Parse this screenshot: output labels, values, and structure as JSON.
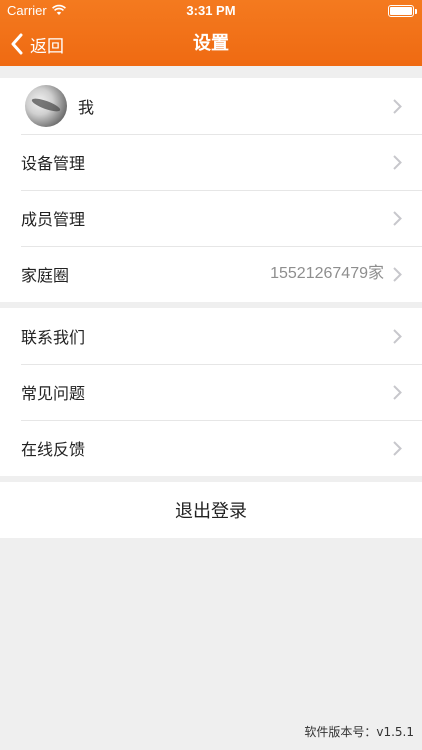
{
  "status_bar": {
    "carrier": "Carrier",
    "time": "3:31 PM"
  },
  "nav": {
    "back_label": "返回",
    "title": "设置"
  },
  "profile": {
    "name": "我"
  },
  "group1": [
    {
      "label": "设备管理",
      "value": ""
    },
    {
      "label": "成员管理",
      "value": ""
    },
    {
      "label": "家庭圈",
      "value": "15521267479家"
    }
  ],
  "group2": [
    {
      "label": "联系我们"
    },
    {
      "label": "常见问题"
    },
    {
      "label": "在线反馈"
    }
  ],
  "logout_label": "退出登录",
  "version": "软件版本号：v1.5.1",
  "colors": {
    "header": "#f47a1f",
    "background": "#efefef"
  },
  "icons": [
    "wifi-icon",
    "battery-icon",
    "back-icon",
    "chevron-icon",
    "avatar"
  ]
}
